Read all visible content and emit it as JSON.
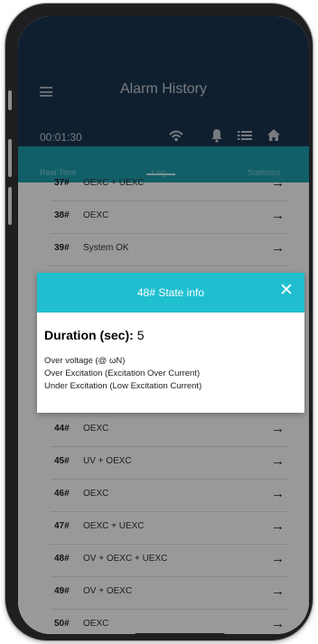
{
  "header": {
    "title": "Alarm History"
  },
  "status": {
    "clock": "00:01:30"
  },
  "tabs": [
    {
      "label": "Real Time"
    },
    {
      "label": "Log"
    },
    {
      "label": "Statistics"
    }
  ],
  "list": {
    "rows": [
      {
        "num": "37#",
        "text": "OEXC + UEXC",
        "arrow": "→"
      },
      {
        "num": "38#",
        "text": "OEXC",
        "arrow": "→"
      },
      {
        "num": "39#",
        "text": "System OK",
        "arrow": "→"
      },
      {
        "num": "44#",
        "text": "OEXC",
        "arrow": "→"
      },
      {
        "num": "45#",
        "text": "UV + OEXC",
        "arrow": "→"
      },
      {
        "num": "46#",
        "text": "OEXC",
        "arrow": "→"
      },
      {
        "num": "47#",
        "text": "OEXC + UEXC",
        "arrow": "→"
      },
      {
        "num": "48#",
        "text": "OV + OEXC + UEXC",
        "arrow": "→"
      },
      {
        "num": "49#",
        "text": "OV + OEXC",
        "arrow": "→"
      },
      {
        "num": "50#",
        "text": "OEXC",
        "arrow": "→"
      }
    ]
  },
  "dialog": {
    "title": "48# State info",
    "close": "✕",
    "duration_label": "Duration (sec):",
    "duration_value": "5",
    "lines": [
      "Over voltage (@ ωN)",
      "Over Excitation (Excitation Over Current)",
      "Under Excitation (Low Excitation Current)"
    ]
  },
  "colors": {
    "header_bg": "#1b3550",
    "tab_bg": "#1d9fae",
    "dialog_header_bg": "#1fbfd0"
  },
  "icons": [
    "menu-icon",
    "wifi-icon",
    "bell-icon",
    "list-icon",
    "home-icon",
    "arrow-right-icon",
    "close-icon"
  ]
}
